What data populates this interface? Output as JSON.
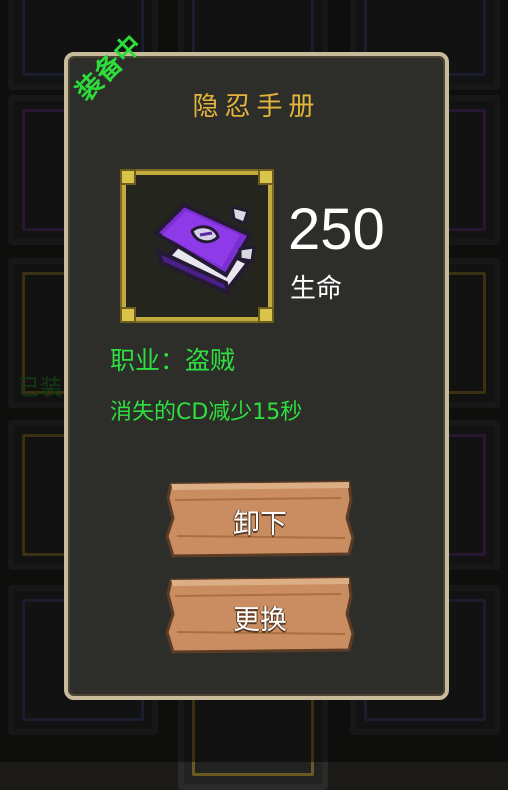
{
  "dialog": {
    "equipped_badge": "装备中",
    "title": "隐忍手册",
    "item_icon": "purple-book-icon",
    "stat": {
      "value": "250",
      "label": "生命"
    },
    "class_line": "职业：盗贼",
    "effect_line": "消失的CD减少15秒",
    "buttons": {
      "unequip": "卸下",
      "swap": "更换"
    }
  },
  "background": {
    "partial_label": "已装"
  },
  "colors": {
    "accent_green": "#2ee03f",
    "title_gold": "#e4b53c",
    "frame_gold": "#c2ab3c",
    "wood": "#c98d61",
    "panel": "#2d2d2a",
    "panel_border": "#c8bb9b"
  }
}
